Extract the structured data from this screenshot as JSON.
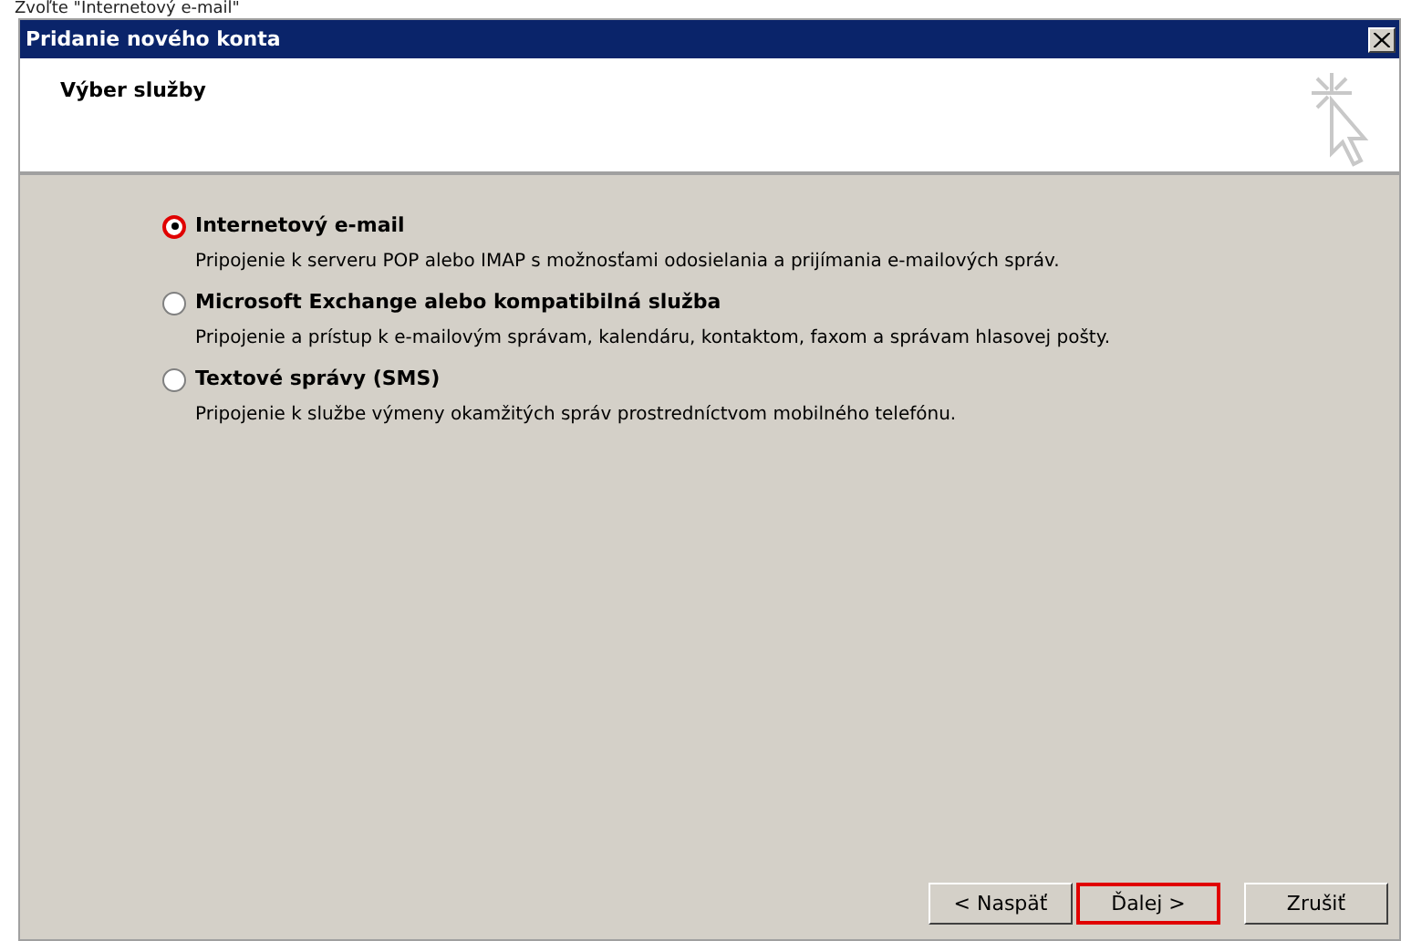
{
  "caption": "Zvoľte \"Internetový e-mail\"",
  "window": {
    "title": "Pridanie nového konta",
    "heading": "Výber služby"
  },
  "options": [
    {
      "label": "Internetový e-mail",
      "description": "Pripojenie k serveru POP alebo IMAP s možnosťami odosielania a prijímania e-mailových správ.",
      "selected": true
    },
    {
      "label": "Microsoft Exchange alebo kompatibilná služba",
      "description": "Pripojenie a prístup k e-mailovým správam, kalendáru, kontaktom, faxom a správam hlasovej pošty.",
      "selected": false
    },
    {
      "label": "Textové správy (SMS)",
      "description": "Pripojenie k službe výmeny okamžitých správ prostredníctvom mobilného telefónu.",
      "selected": false
    }
  ],
  "buttons": [
    {
      "label": "< Naspäť",
      "highlighted": false
    },
    {
      "label": "Ďalej >",
      "highlighted": true
    },
    {
      "label": "Zrušiť",
      "highlighted": false
    }
  ]
}
